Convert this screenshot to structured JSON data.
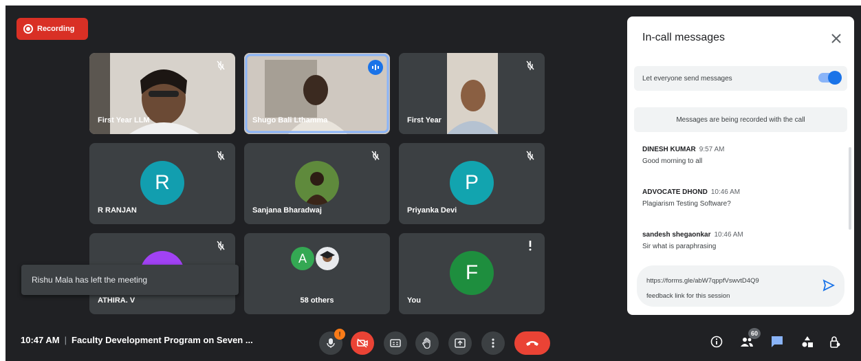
{
  "recording": {
    "label": "Recording"
  },
  "tiles": [
    {
      "name": "First Year LLM",
      "type": "video"
    },
    {
      "name": "Shugo Bali Lthamma",
      "type": "video"
    },
    {
      "name": "First Year",
      "type": "video"
    },
    {
      "name": "R RANJAN",
      "initial": "R",
      "color": "#129eaf"
    },
    {
      "name": "Sanjana Bharadwaj",
      "type": "photo"
    },
    {
      "name": "Priyanka Devi",
      "initial": "P",
      "color": "#12a4af"
    },
    {
      "name": "ATHIRA. V",
      "color": "#a142f4"
    },
    {
      "name": "58 others",
      "initial": "A",
      "color": "#34a853"
    },
    {
      "name": "You",
      "initial": "F",
      "color": "#1e8e3e"
    }
  ],
  "toast": "Rishu Mala has left the meeting",
  "panel": {
    "title": "In-call messages",
    "toggle_label": "Let everyone send messages",
    "notice": "Messages are being recorded with the call",
    "messages": [
      {
        "sender": "DINESH KUMAR",
        "time": "9:57 AM",
        "text": "Good morning to all"
      },
      {
        "sender": "ADVOCATE DHOND",
        "time": "10:46 AM",
        "text": "Plagiarism Testing Software?"
      },
      {
        "sender": "sandesh shegaonkar",
        "time": "10:46 AM",
        "text": "Sir what is paraphrasing"
      }
    ],
    "draft_line1": "https://forms.gle/abW7qppfVswvtD4Q9",
    "draft_line2": "feedback link for this session"
  },
  "bottom": {
    "time": "10:47 AM",
    "meeting_title": "Faculty Development Program on Seven ...",
    "participant_count": "60",
    "mic_badge": "!"
  },
  "colors": {
    "background": "#202124",
    "tile": "#3c4043",
    "accent": "#1a73e8",
    "danger": "#ea4335"
  }
}
